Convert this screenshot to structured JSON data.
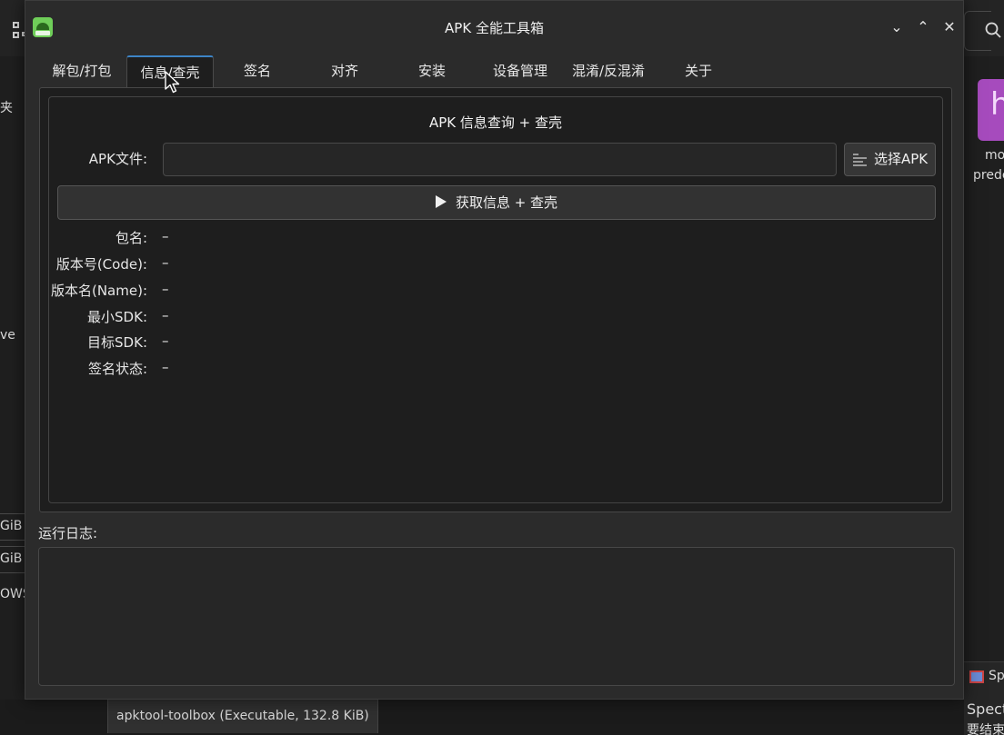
{
  "window": {
    "title": "APK 全能工具箱",
    "controls": [
      "⌄",
      "⌃",
      "✕"
    ]
  },
  "tabs": [
    {
      "label": "解包/打包",
      "active": false
    },
    {
      "label": "信息/查壳",
      "active": true
    },
    {
      "label": "签名",
      "active": false
    },
    {
      "label": "对齐",
      "active": false
    },
    {
      "label": "安装",
      "active": false
    },
    {
      "label": "设备管理",
      "active": false
    },
    {
      "label": "混淆/反混淆",
      "active": false
    },
    {
      "label": "关于",
      "active": false
    }
  ],
  "info_tab": {
    "group_title": "APK 信息查询 + 查壳",
    "apk_file_label": "APK文件:",
    "apk_file_value": "",
    "choose_button": "选择APK",
    "run_button": "获取信息 + 查壳",
    "fields": [
      {
        "label": "包名:",
        "value": "–"
      },
      {
        "label": "版本号(Code):",
        "value": "–"
      },
      {
        "label": "版本名(Name):",
        "value": "–"
      },
      {
        "label": "最小SDK:",
        "value": "–"
      },
      {
        "label": "目标SDK:",
        "value": "–"
      },
      {
        "label": "签名状态:",
        "value": "–"
      }
    ]
  },
  "log": {
    "label": "运行日志:",
    "content": ""
  },
  "background": {
    "left_texts": [
      "夹",
      "ve",
      "GiB p",
      "GiB p",
      "OWS"
    ],
    "right_texts": [
      "mo",
      "prede",
      "Sp",
      "Spect",
      "要结束"
    ],
    "right_thumb_letter": "h",
    "status_item": "apktool-toolbox (Executable, 132.8 KiB)"
  },
  "colors": {
    "accent": "#3d84c6",
    "app_icon": "#6fce59",
    "thumb": "#a64bbd"
  }
}
